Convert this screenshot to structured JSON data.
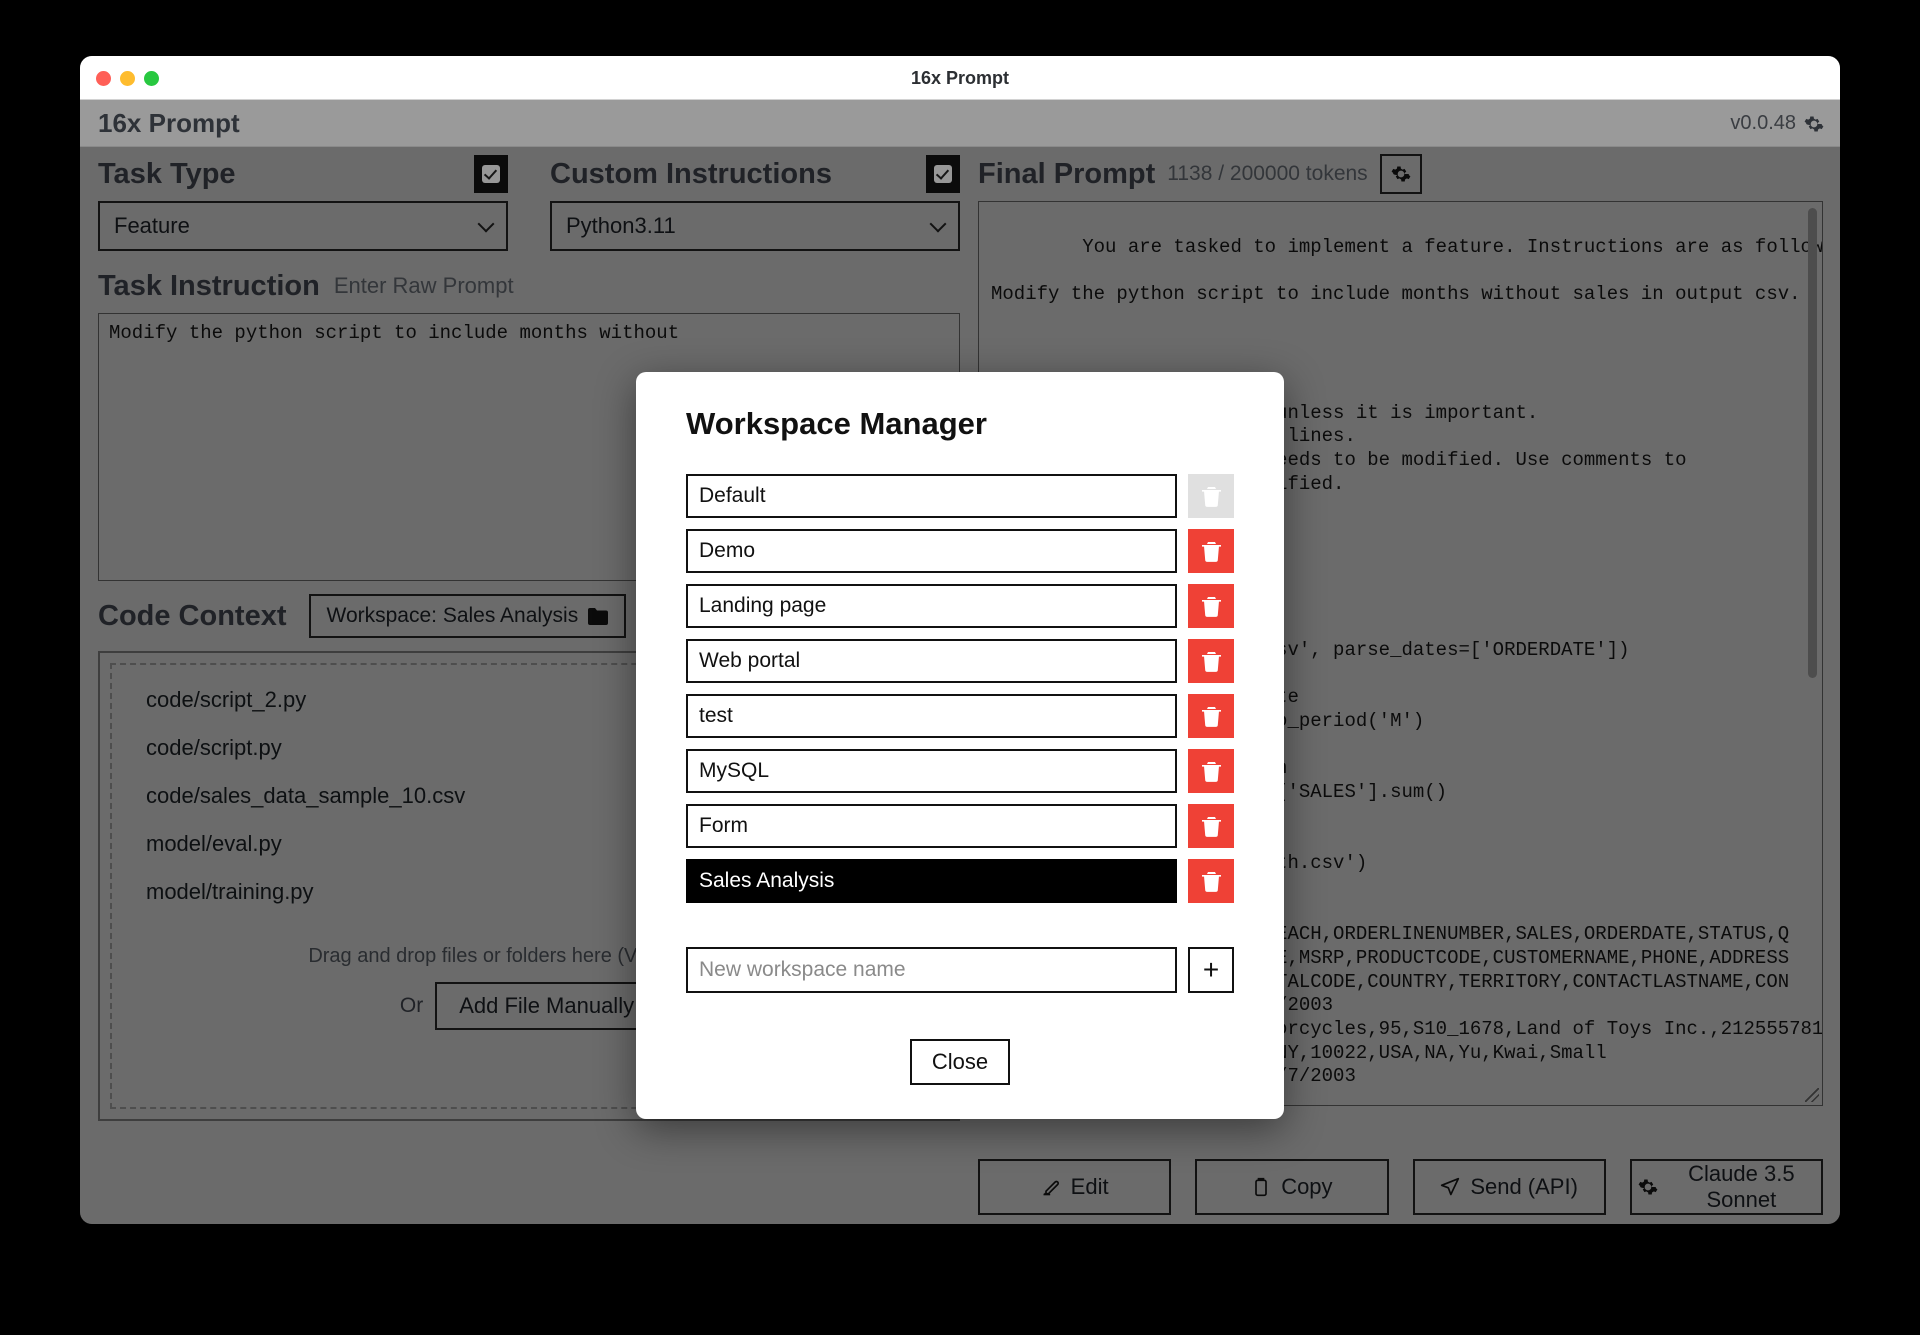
{
  "window": {
    "title": "16x Prompt"
  },
  "header": {
    "app_name": "16x Prompt",
    "version": "v0.0.48",
    "gear_icon": "gear-icon"
  },
  "task_type": {
    "label": "Task Type",
    "checkbox_checked": true,
    "selected": "Feature"
  },
  "custom_instructions": {
    "label": "Custom Instructions",
    "checkbox_checked": true,
    "selected": "Python3.11"
  },
  "task_instruction": {
    "label": "Task Instruction",
    "sublabel": "Enter Raw Prompt",
    "value": "Modify the python script to include months without"
  },
  "code_context": {
    "label": "Code Context",
    "workspace_button": "Workspace: Sales Analysis",
    "workspace_icon": "folder-icon",
    "files": [
      "code/script_2.py",
      "code/script.py",
      "code/sales_data_sample_10.csv",
      "model/eval.py",
      "model/training.py"
    ],
    "dnd_text": "Drag and drop files or folders here (VS Code/IDE)",
    "or_text": "Or",
    "add_file_button": "Add File Manually"
  },
  "final_prompt": {
    "label": "Final Prompt",
    "token_count": "1138 / 200000 tokens",
    "gear_icon": "gear-icon",
    "text": "You are tasked to implement a feature. Instructions are as follows:\n\nModify the python script to include months without sales in output csv.\n\n\n\n                   format:\n                 ptions, unless it is important.\n                 nd empty lines.\n                 e that needs to be modified. Use comments to\n                  not modified.\n\n\n\n\n\n\n           ta_sample_10.csv', parse_dates=['ORDERDATE'])\n\n           m the order date\n           DERDATE'].dt.to_period('M')\n\n           amount by month\n           y('YearMonth')['SALES'].sum()\n\n           ile\n           _amount_by_month.csv')\n\n           v\n                    PRICEEACH,ORDERLINENUMBER,SALES,ORDERDATE,STATUS,Q\n                    CTLINE,MSRP,PRODUCTCODE,CUSTOMERNAME,PHONE,ADDRESS\n                    E,POSTALCODE,COUNTRY,TERRITORY,CONTACTLASTNAME,CON\n10107,30,95.7,2,2871,2/24/2003\n0:00,Shipped,1,2,2003,Motorcycles,95,S10_1678,Land of Toys Inc.,2125557818,897\nLong Airport Avenue,,NYC,NY,10022,USA,NA,Yu,Kwai,Small\n10121,34,81.35,5,2765,0,5/7/2003"
  },
  "toolbar": {
    "buttons": [
      {
        "label": "Edit",
        "icon": "pencil-square-icon"
      },
      {
        "label": "Copy",
        "icon": "clipboard-icon"
      },
      {
        "label": "Send (API)",
        "icon": "paper-plane-icon"
      },
      {
        "label": "Claude 3.5 Sonnet",
        "icon": "gear-icon"
      }
    ]
  },
  "modal": {
    "title": "Workspace Manager",
    "workspaces": [
      {
        "name": "Default",
        "selected": false,
        "delete_enabled": false
      },
      {
        "name": "Demo",
        "selected": false,
        "delete_enabled": true
      },
      {
        "name": "Landing page",
        "selected": false,
        "delete_enabled": true
      },
      {
        "name": "Web portal",
        "selected": false,
        "delete_enabled": true
      },
      {
        "name": "test",
        "selected": false,
        "delete_enabled": true
      },
      {
        "name": "MySQL",
        "selected": false,
        "delete_enabled": true
      },
      {
        "name": "Form",
        "selected": false,
        "delete_enabled": true
      },
      {
        "name": "Sales Analysis",
        "selected": true,
        "delete_enabled": true
      }
    ],
    "new_workspace_placeholder": "New workspace name",
    "new_workspace_value": "",
    "add_button_label": "+",
    "close_button_label": "Close",
    "delete_icon": "trash-icon"
  },
  "colors": {
    "delete_red": "#ef4136",
    "delete_disabled": "#e0e0e0",
    "app_background": "#9a9a9a",
    "selected_row": "#000000"
  }
}
